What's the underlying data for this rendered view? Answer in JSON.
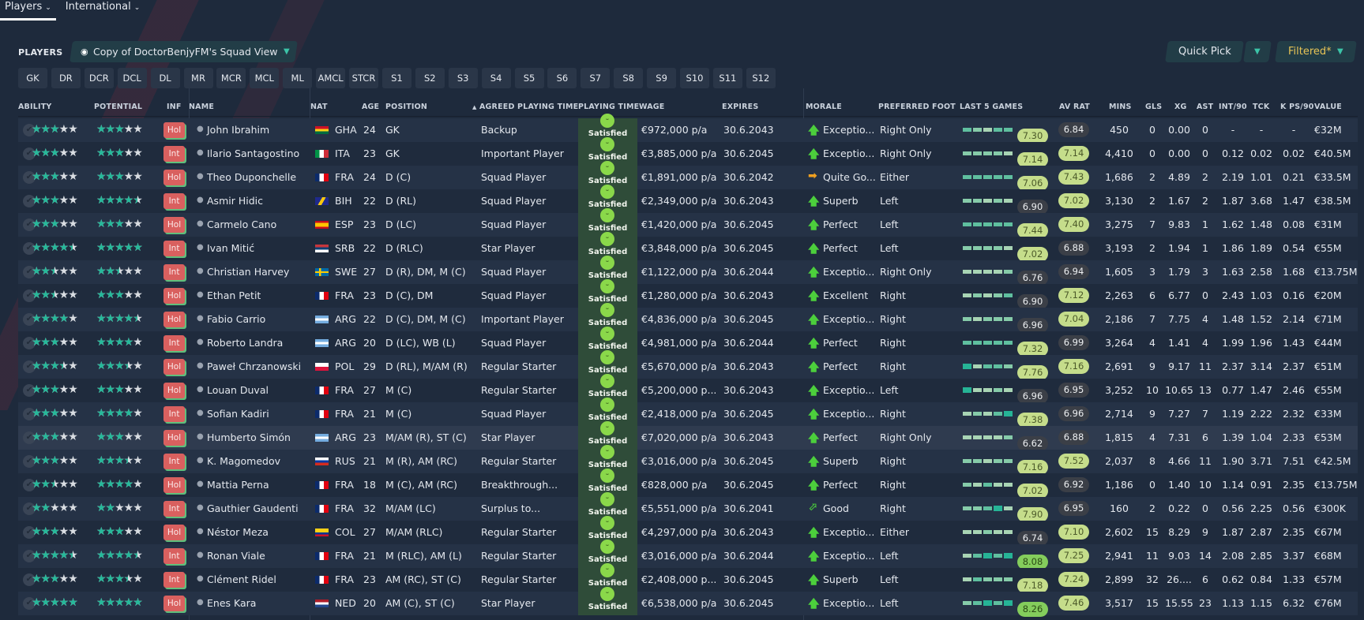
{
  "topnav": {
    "tabs": [
      {
        "label": "Players"
      },
      {
        "label": "International"
      }
    ]
  },
  "section_label": "PLAYERS",
  "view": {
    "label": "Copy of DoctorBenjyFM's Squad View",
    "icon": "eye-icon"
  },
  "quick_pick": "Quick Pick",
  "filter": {
    "label": "Filtered*",
    "color": "#e8c455"
  },
  "position_buttons": [
    "GK",
    "DR",
    "DCR",
    "DCL",
    "DL",
    "MR",
    "MCR",
    "MCL",
    "ML",
    "AMCL",
    "STCR",
    "S1",
    "S2",
    "S3",
    "S4",
    "S5",
    "S6",
    "S7",
    "S8",
    "S9",
    "S10",
    "S11",
    "S12"
  ],
  "columns": {
    "ability": "ABILITY",
    "potential": "POTENTIAL",
    "inf": "INF",
    "name": "NAME",
    "nat": "NAT",
    "age": "AGE",
    "position": "POSITION",
    "agreed": "AGREED PLAYING TIME",
    "playing": "PLAYING TIME",
    "wage": "WAGE",
    "expires": "EXPIRES",
    "morale": "MORALE",
    "foot": "PREFERRED FOOT",
    "last5": "LAST 5 GAMES",
    "avrat": "AV RAT",
    "mins": "MINS",
    "gls": "GLS",
    "xg": "XG",
    "ast": "AST",
    "int90": "INT/90",
    "tck": "TCK",
    "kps90": "K PS/90",
    "value": "VALUE"
  },
  "sort": {
    "column": "agreed",
    "direction": "ascending"
  },
  "colors": {
    "star": "#26b99a",
    "playing_time_bg": "#2f4c39",
    "inf_badge": "#d9605f",
    "rating_good": "#c5dd8b",
    "rating_great": "#84cd5c",
    "rating_low": "#3b3f47"
  },
  "players": [
    {
      "ability": 3,
      "potential": 3,
      "inf": "Hol",
      "name": "John Ibrahim",
      "nat": "GHA",
      "age": "24",
      "position": "GK",
      "agreed": "Backup",
      "playing": "Satisfied",
      "wage": "€972,000 p/a",
      "expires": "30.6.2043",
      "morale": "Exceptio...",
      "morale_icon": "up",
      "foot": "Right Only",
      "last5": [
        3,
        2,
        1,
        3,
        3
      ],
      "last5_avg": "7.30",
      "avrat": "6.84",
      "mins": "450",
      "gls": "0",
      "xg": "0.00",
      "ast": "0",
      "int90": "-",
      "tck": "-",
      "kps90": "-",
      "value": "€32M"
    },
    {
      "ability": 3,
      "potential": 3,
      "inf": "Int",
      "name": "Ilario Santagostino",
      "nat": "ITA",
      "age": "23",
      "position": "GK",
      "agreed": "Important Player",
      "playing": "Satisfied",
      "wage": "€3,885,000 p/a",
      "expires": "30.6.2045",
      "morale": "Exceptio...",
      "morale_icon": "up",
      "foot": "Right Only",
      "last5": [
        2,
        2,
        2,
        2,
        1
      ],
      "last5_avg": "7.14",
      "avrat": "7.14",
      "mins": "4,410",
      "gls": "0",
      "xg": "0.00",
      "ast": "0",
      "int90": "0.12",
      "tck": "0.02",
      "kps90": "0.02",
      "value": "€40.5M"
    },
    {
      "ability": 3,
      "potential": 3,
      "inf": "Hol",
      "name": "Theo Duponchelle",
      "nat": "FRA",
      "age": "24",
      "position": "D (C)",
      "agreed": "Squad Player",
      "playing": "Satisfied",
      "wage": "€1,891,000 p/a",
      "expires": "30.6.2042",
      "morale": "Quite Go...",
      "morale_icon": "right",
      "foot": "Either",
      "last5": [
        3,
        3,
        3,
        3,
        3
      ],
      "last5_avg": "7.06",
      "avrat": "7.43",
      "mins": "1,686",
      "gls": "2",
      "xg": "4.89",
      "ast": "2",
      "int90": "2.19",
      "tck": "1.01",
      "kps90": "0.21",
      "value": "€33.5M"
    },
    {
      "ability": 3,
      "potential": 4.5,
      "inf": "Int",
      "name": "Asmir Hidic",
      "nat": "BIH",
      "age": "22",
      "position": "D (RL)",
      "agreed": "Squad Player",
      "playing": "Satisfied",
      "wage": "€2,349,000 p/a",
      "expires": "30.6.2043",
      "morale": "Superb",
      "morale_icon": "up",
      "foot": "Left",
      "last5": [
        2,
        2,
        1,
        2,
        1
      ],
      "last5_avg": "6.90",
      "avrat": "7.02",
      "mins": "3,130",
      "gls": "2",
      "xg": "1.67",
      "ast": "2",
      "int90": "1.87",
      "tck": "3.68",
      "kps90": "1.47",
      "value": "€38.5M"
    },
    {
      "ability": 3,
      "potential": 3,
      "inf": "Hol",
      "name": "Carmelo Cano",
      "nat": "ESP",
      "age": "23",
      "position": "D (LC)",
      "agreed": "Squad Player",
      "playing": "Satisfied",
      "wage": "€1,420,000 p/a",
      "expires": "30.6.2045",
      "morale": "Perfect",
      "morale_icon": "up",
      "foot": "Left",
      "last5": [
        3,
        3,
        3,
        3,
        3
      ],
      "last5_avg": "7.44",
      "avrat": "7.40",
      "mins": "3,275",
      "gls": "7",
      "xg": "9.83",
      "ast": "1",
      "int90": "1.62",
      "tck": "1.48",
      "kps90": "0.08",
      "value": "€31M"
    },
    {
      "ability": 4.5,
      "potential": 5,
      "inf": "Int",
      "name": "Ivan Mitić",
      "nat": "SRB",
      "age": "22",
      "position": "D (RLC)",
      "agreed": "Star Player",
      "playing": "Satisfied",
      "wage": "€3,848,000 p/a",
      "expires": "30.6.2045",
      "morale": "Perfect",
      "morale_icon": "up",
      "foot": "Left",
      "last5": [
        2,
        2,
        2,
        2,
        1
      ],
      "last5_avg": "7.02",
      "avrat": "6.88",
      "mins": "3,193",
      "gls": "2",
      "xg": "1.94",
      "ast": "1",
      "int90": "1.86",
      "tck": "1.89",
      "kps90": "0.54",
      "value": "€55M"
    },
    {
      "ability": 2.5,
      "potential": 2.5,
      "inf": "Int",
      "name": "Christian Harvey",
      "nat": "SWE",
      "age": "27",
      "position": "D (R), DM, M (C)",
      "agreed": "Squad Player",
      "playing": "Satisfied",
      "wage": "€1,122,000 p/a",
      "expires": "30.6.2044",
      "morale": "Exceptio...",
      "morale_icon": "up",
      "foot": "Right Only",
      "last5": [
        1,
        1,
        1,
        1,
        2
      ],
      "last5_avg": "6.76",
      "avrat": "6.94",
      "mins": "1,605",
      "gls": "3",
      "xg": "1.79",
      "ast": "3",
      "int90": "1.63",
      "tck": "2.58",
      "kps90": "1.68",
      "value": "€13.75M"
    },
    {
      "ability": 2.5,
      "potential": 3,
      "inf": "Hol",
      "name": "Ethan Petit",
      "nat": "FRA",
      "age": "23",
      "position": "D (C), DM",
      "agreed": "Squad Player",
      "playing": "Satisfied",
      "wage": "€1,280,000 p/a",
      "expires": "30.6.2043",
      "morale": "Excellent",
      "morale_icon": "up",
      "foot": "Right",
      "last5": [
        1,
        2,
        1,
        2,
        3
      ],
      "last5_avg": "6.90",
      "avrat": "7.12",
      "mins": "2,263",
      "gls": "6",
      "xg": "6.77",
      "ast": "0",
      "int90": "2.43",
      "tck": "1.03",
      "kps90": "0.16",
      "value": "€20M"
    },
    {
      "ability": 4,
      "potential": 4.5,
      "inf": "Hol",
      "name": "Fabio Carrio",
      "nat": "ARG",
      "age": "22",
      "position": "D (C), DM, M (C)",
      "agreed": "Important Player",
      "playing": "Satisfied",
      "wage": "€4,836,000 p/a",
      "expires": "30.6.2045",
      "morale": "Exceptio...",
      "morale_icon": "up",
      "foot": "Right",
      "last5": [
        2,
        1,
        2,
        2,
        2
      ],
      "last5_avg": "6.96",
      "avrat": "7.04",
      "mins": "2,186",
      "gls": "7",
      "xg": "7.75",
      "ast": "4",
      "int90": "1.48",
      "tck": "1.52",
      "kps90": "2.14",
      "value": "€71M"
    },
    {
      "ability": 3,
      "potential": 4,
      "inf": "Int",
      "name": "Roberto Landra",
      "nat": "ARG",
      "age": "20",
      "position": "D (LC), WB (L)",
      "agreed": "Squad Player",
      "playing": "Satisfied",
      "wage": "€4,981,000 p/a",
      "expires": "30.6.2044",
      "morale": "Perfect",
      "morale_icon": "up",
      "foot": "Right",
      "last5": [
        3,
        3,
        3,
        3,
        3
      ],
      "last5_avg": "7.32",
      "avrat": "6.99",
      "mins": "3,264",
      "gls": "4",
      "xg": "1.41",
      "ast": "4",
      "int90": "1.99",
      "tck": "1.96",
      "kps90": "1.43",
      "value": "€44M"
    },
    {
      "ability": 3.5,
      "potential": 3.5,
      "inf": "Hol",
      "name": "Paweł Chrzanowski",
      "nat": "POL",
      "age": "29",
      "position": "D (RL), M/AM (R)",
      "agreed": "Regular Starter",
      "playing": "Satisfied",
      "wage": "€5,670,000 p/a",
      "expires": "30.6.2043",
      "morale": "Perfect",
      "morale_icon": "up",
      "foot": "Right",
      "last5": [
        4,
        1,
        3,
        3,
        2
      ],
      "last5_avg": "7.76",
      "avrat": "7.16",
      "mins": "2,691",
      "gls": "9",
      "xg": "9.17",
      "ast": "11",
      "int90": "2.37",
      "tck": "3.14",
      "kps90": "2.37",
      "value": "€51M"
    },
    {
      "ability": 3,
      "potential": 3,
      "inf": "Hol",
      "name": "Louan Duval",
      "nat": "FRA",
      "age": "27",
      "position": "M (C)",
      "agreed": "Regular Starter",
      "playing": "Satisfied",
      "wage": "€5,200,000 p...",
      "expires": "30.6.2043",
      "morale": "Exceptio...",
      "morale_icon": "up",
      "foot": "Left",
      "last5": [
        4,
        1,
        1,
        2,
        1
      ],
      "last5_avg": "6.96",
      "avrat": "6.95",
      "mins": "3,252",
      "gls": "10",
      "xg": "10.65",
      "ast": "13",
      "int90": "0.77",
      "tck": "1.47",
      "kps90": "2.46",
      "value": "€55M"
    },
    {
      "ability": 3,
      "potential": 4,
      "inf": "Int",
      "name": "Sofian Kadiri",
      "nat": "FRA",
      "age": "21",
      "position": "M (C)",
      "agreed": "Squad Player",
      "playing": "Satisfied",
      "wage": "€2,418,000 p/a",
      "expires": "30.6.2045",
      "morale": "Exceptio...",
      "morale_icon": "up",
      "foot": "Right",
      "last5": [
        1,
        2,
        1,
        3,
        4
      ],
      "last5_avg": "7.38",
      "avrat": "6.96",
      "mins": "2,714",
      "gls": "9",
      "xg": "7.27",
      "ast": "7",
      "int90": "1.19",
      "tck": "2.22",
      "kps90": "2.32",
      "value": "€33M"
    },
    {
      "ability": 3,
      "potential": 3,
      "inf": "Hol",
      "name": "Humberto Simón",
      "nat": "ARG",
      "age": "23",
      "position": "M/AM (R), ST (C)",
      "agreed": "Star Player",
      "playing": "Satisfied",
      "wage": "€7,020,000 p/a",
      "expires": "30.6.2043",
      "morale": "Perfect",
      "morale_icon": "up",
      "foot": "Right Only",
      "last5": [
        1,
        1,
        1,
        1,
        2
      ],
      "last5_avg": "6.62",
      "avrat": "6.88",
      "mins": "1,815",
      "gls": "4",
      "xg": "7.31",
      "ast": "6",
      "int90": "1.39",
      "tck": "1.04",
      "kps90": "2.33",
      "value": "€53M",
      "highlighted": true
    },
    {
      "ability": 3,
      "potential": 3.5,
      "inf": "Int",
      "name": "K. Magomedov",
      "nat": "RUS",
      "age": "21",
      "position": "M (R), AM (RC)",
      "agreed": "Regular Starter",
      "playing": "Satisfied",
      "wage": "€3,016,000 p/a",
      "expires": "30.6.2045",
      "morale": "Superb",
      "morale_icon": "up",
      "foot": "Right",
      "last5": [
        2,
        2,
        1,
        2,
        2
      ],
      "last5_avg": "7.16",
      "avrat": "7.52",
      "mins": "2,037",
      "gls": "8",
      "xg": "4.66",
      "ast": "11",
      "int90": "1.90",
      "tck": "3.71",
      "kps90": "7.51",
      "value": "€42.5M"
    },
    {
      "ability": 2.5,
      "potential": 4,
      "inf": "Hol",
      "name": "Mattia Perna",
      "nat": "FRA",
      "age": "18",
      "position": "M (C), AM (RC)",
      "agreed": "Breakthrough...",
      "playing": "Satisfied",
      "wage": "€828,000 p/a",
      "expires": "30.6.2045",
      "morale": "Perfect",
      "morale_icon": "up",
      "foot": "Right",
      "last5": [
        2,
        1,
        3,
        1,
        1
      ],
      "last5_avg": "7.02",
      "avrat": "6.92",
      "mins": "1,186",
      "gls": "0",
      "xg": "1.40",
      "ast": "10",
      "int90": "1.14",
      "tck": "0.91",
      "kps90": "2.35",
      "value": "€13.75M"
    },
    {
      "ability": 2,
      "potential": 2,
      "inf": "Int",
      "name": "Gauthier Gaudenti",
      "nat": "FRA",
      "age": "32",
      "position": "M/AM (LC)",
      "agreed": "Surplus to...",
      "playing": "Satisfied",
      "wage": "€5,551,000 p/a",
      "expires": "30.6.2041",
      "morale": "Good",
      "morale_icon": "up-right",
      "foot": "Right",
      "last5": [
        2,
        2,
        3,
        4,
        1
      ],
      "last5_avg": "7.90",
      "avrat": "6.95",
      "mins": "160",
      "gls": "2",
      "xg": "0.22",
      "ast": "0",
      "int90": "0.56",
      "tck": "2.25",
      "kps90": "0.56",
      "value": "€300K"
    },
    {
      "ability": 3,
      "potential": 3,
      "inf": "Hol",
      "name": "Néstor Meza",
      "nat": "COL",
      "age": "27",
      "position": "M/AM (RLC)",
      "agreed": "Regular Starter",
      "playing": "Satisfied",
      "wage": "€4,297,000 p/a",
      "expires": "30.6.2043",
      "morale": "Exceptio...",
      "morale_icon": "up",
      "foot": "Either",
      "last5": [
        1,
        1,
        2,
        1,
        1
      ],
      "last5_avg": "6.74",
      "avrat": "7.10",
      "mins": "2,602",
      "gls": "15",
      "xg": "8.29",
      "ast": "9",
      "int90": "1.87",
      "tck": "2.87",
      "kps90": "2.35",
      "value": "€67M"
    },
    {
      "ability": 4.5,
      "potential": 4.5,
      "inf": "Int",
      "name": "Ronan Viale",
      "nat": "FRA",
      "age": "21",
      "position": "M (RLC), AM (L)",
      "agreed": "Regular Starter",
      "playing": "Satisfied",
      "wage": "€3,016,000 p/a",
      "expires": "30.6.2044",
      "morale": "Exceptio...",
      "morale_icon": "up",
      "foot": "Left",
      "last5": [
        1,
        3,
        4,
        3,
        4
      ],
      "last5_avg": "8.08",
      "avrat": "7.25",
      "mins": "2,941",
      "gls": "11",
      "xg": "9.03",
      "ast": "14",
      "int90": "2.08",
      "tck": "2.85",
      "kps90": "3.37",
      "value": "€68M"
    },
    {
      "ability": 3,
      "potential": 3.5,
      "inf": "Int",
      "name": "Clément Ridel",
      "nat": "FRA",
      "age": "23",
      "position": "AM (RC), ST (C)",
      "agreed": "Regular Starter",
      "playing": "Satisfied",
      "wage": "€2,408,000 p...",
      "expires": "30.6.2045",
      "morale": "Superb",
      "morale_icon": "up",
      "foot": "Left",
      "last5": [
        1,
        3,
        2,
        2,
        2
      ],
      "last5_avg": "7.18",
      "avrat": "7.24",
      "mins": "2,899",
      "gls": "32",
      "xg": "26....",
      "ast": "6",
      "int90": "0.62",
      "tck": "0.84",
      "kps90": "1.33",
      "value": "€57M"
    },
    {
      "ability": 5,
      "potential": 5,
      "inf": "Hol",
      "name": "Enes Kara",
      "nat": "NED",
      "age": "20",
      "position": "AM (C), ST (C)",
      "agreed": "Star Player",
      "playing": "Satisfied",
      "wage": "€6,538,000 p/a",
      "expires": "30.6.2045",
      "morale": "Exceptio...",
      "morale_icon": "up",
      "foot": "Left",
      "last5": [
        2,
        3,
        4,
        3,
        4
      ],
      "last5_avg": "8.26",
      "avrat": "7.46",
      "mins": "3,517",
      "gls": "15",
      "xg": "15.55",
      "ast": "23",
      "int90": "1.13",
      "tck": "1.15",
      "kps90": "6.32",
      "value": "€76M"
    }
  ]
}
